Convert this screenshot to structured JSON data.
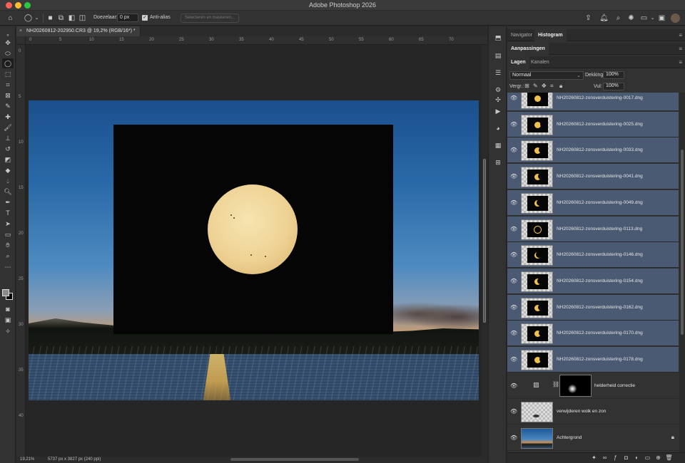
{
  "app": {
    "title": "Adobe Photoshop 2026"
  },
  "options_bar": {
    "feather_label": "Doezelaar:",
    "feather_value": "0 px",
    "antialias_label": "Anti-alias",
    "select_mask_label": "Selecteren en maskeren..."
  },
  "document": {
    "tab_title": "NH20260812-202950.CR3 @ 19,2% (RGB/16*) *",
    "ruler_h": [
      "0",
      "5",
      "10",
      "15",
      "20",
      "25",
      "30",
      "35",
      "40",
      "45",
      "50",
      "55",
      "60",
      "65",
      "70"
    ],
    "ruler_v": [
      "0",
      "5",
      "10",
      "15",
      "20",
      "25",
      "30",
      "35",
      "40"
    ]
  },
  "status": {
    "zoom": "19,21%",
    "doc_info": "5737 px x 3827 px (240 ppi)"
  },
  "panels": {
    "top_tabs": [
      "Navigator",
      "Histogram"
    ],
    "adjust_tab": "Aanpassingen",
    "layer_tabs": [
      "Lagen",
      "Kanalen"
    ],
    "blend_mode": "Normaal",
    "opacity_label": "Dekking:",
    "opacity_value": "100%",
    "lock_label": "Vergr.:",
    "fill_label": "Vul:",
    "fill_value": "100%"
  },
  "layers": [
    {
      "name": "NH20260812-zonsverduistering-0017.dng",
      "phase": 0.05
    },
    {
      "name": "NH20260812-zonsverduistering-0025.dng",
      "phase": 0.15
    },
    {
      "name": "NH20260812-zonsverduistering-0033.dng",
      "phase": 0.3
    },
    {
      "name": "NH20260812-zonsverduistering-0041.dng",
      "phase": 0.45
    },
    {
      "name": "NH20260812-zonsverduistering-0049.dng",
      "phase": 0.65
    },
    {
      "name": "NH20260812-zonsverduistering-0113.dng",
      "phase": 1.0
    },
    {
      "name": "NH20260812-zonsverduistering-0146.dng",
      "phase": 0.75
    },
    {
      "name": "NH20260812-zonsverduistering-0154.dng",
      "phase": 0.6
    },
    {
      "name": "NH20260812-zonsverduistering-0162.dng",
      "phase": 0.45
    },
    {
      "name": "NH20260812-zonsverduistering-0170.dng",
      "phase": 0.3
    },
    {
      "name": "NH20260812-zonsverduistering-0178.dng",
      "phase": 0.2
    },
    {
      "name": "helderheid correctie",
      "kind": "adjustment"
    },
    {
      "name": "verwijderen wolk en zon",
      "kind": "empty"
    },
    {
      "name": "Achtergrond",
      "kind": "background"
    }
  ],
  "colors": {
    "selected_layer": "#4b5a73",
    "accent": "#f1c14a"
  }
}
